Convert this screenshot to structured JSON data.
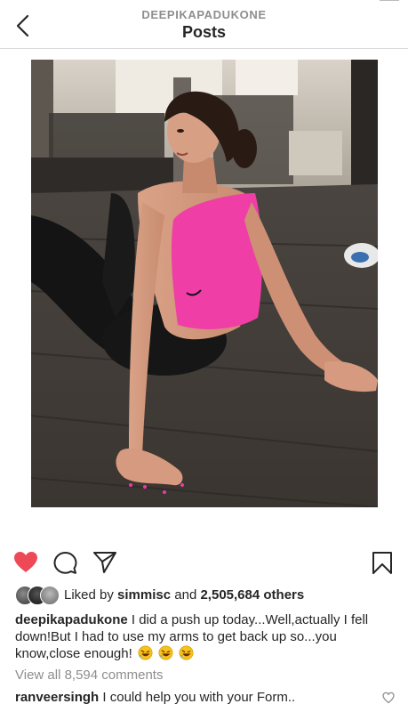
{
  "header": {
    "username": "DEEPIKAPADUKONE",
    "title": "Posts"
  },
  "post": {
    "photo_icon": "gym-photo",
    "liked": true,
    "like_color": "#ed4956",
    "likes": {
      "prefix": "Liked by ",
      "first_user": "simmisc",
      "middle": " and ",
      "count": "2,505,684 others"
    },
    "caption": {
      "user": "deepikapadukone",
      "text": "I did a push up today...Well,actually I fell down!But I had to use my arms to get back up so...you know,close enough!",
      "emoji_icon": "rolling-on-floor-laughing-emoji"
    },
    "view_comments": "View all 8,594 comments",
    "comment": {
      "user": "ranveersingh",
      "text": "I could help you with your Form.."
    }
  },
  "icons": {
    "back": "chevron-left-icon",
    "like": "heart-icon",
    "comment": "speech-bubble-icon",
    "share": "paper-plane-icon",
    "save": "bookmark-icon",
    "comment_like": "small-heart-icon"
  }
}
